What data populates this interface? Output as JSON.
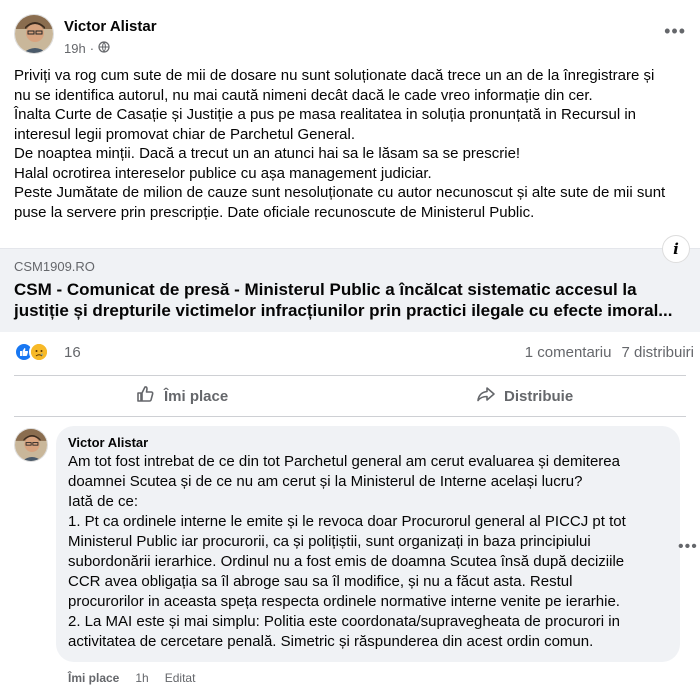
{
  "post": {
    "author": "Victor Alistar",
    "time": "19h",
    "dot": "·",
    "privacy_icon": "globe-icon",
    "more_label": "•••",
    "paragraphs": [
      "Priviți va rog cum sute de mii de dosare nu sunt soluționate dacă trece un an de la înregistrare și",
      "nu se identifica autorul, nu mai caută nimeni decât dacă le cade vreo informație din cer.",
      "Înalta Curte de Casație și Justiție a pus pe masa realitatea in soluția pronunțată in Recursul in",
      "interesul legii promovat chiar de Parchetul General.",
      "De noaptea minții. Dacă a trecut un an atunci hai sa le lăsam sa se prescrie!",
      "Halal ocrotirea intereselor publice cu așa management judiciar.",
      "Peste Jumătate de milion de cauze sunt nesoluționate cu autor necunoscut și alte sute de mii sunt",
      "puse la servere prin prescripție. Date oficiale recunoscute de Ministerul Public."
    ]
  },
  "link": {
    "domain": "CSM1909.RO",
    "title_line1": "CSM - Comunicat de presă - Ministerul Public a încălcat sistematic accesul la",
    "title_line2": "justiție și drepturile victimelor infracțiunilor prin practici ilegale cu efecte imoral...",
    "info_label": "i"
  },
  "reactions": {
    "count": "16",
    "comments": "1 comentariu",
    "shares": "7 distribuiri",
    "icons": [
      "like-icon",
      "sad-icon"
    ]
  },
  "actions": {
    "like_label": "Îmi place",
    "share_label": "Distribuie"
  },
  "comment": {
    "author": "Victor Alistar",
    "lines": [
      "Am tot fost intrebat de ce din tot Parchetul general am cerut evaluarea și demiterea",
      "doamnei Scutea și de ce nu am cerut și la Ministerul de Interne același lucru?",
      "Iată de ce:",
      "1. Pt ca ordinele interne le emite și le revoca doar Procurorul general al PICCJ pt tot",
      "Ministerul Public iar procurorii, ca și polițiștii, sunt organizați in baza principiului",
      "subordonării ierarhice. Ordinul nu a fost emis de doamna Scutea însă după deciziile",
      "CCR avea obligația sa îl abroge sau sa îl modifice, și nu a făcut asta. Restul",
      "procurorilor in aceasta speța respecta ordinele normative interne venite pe ierarhie.",
      "2. La MAI este și mai simplu: Politia este coordonata/supravegheata de procurori in",
      "activitatea de cercetare penală. Simetric și răspunderea din acest ordin comun."
    ],
    "more_label": "•••",
    "like_label": "Îmi place",
    "time": "1h",
    "edited": "Editat"
  }
}
